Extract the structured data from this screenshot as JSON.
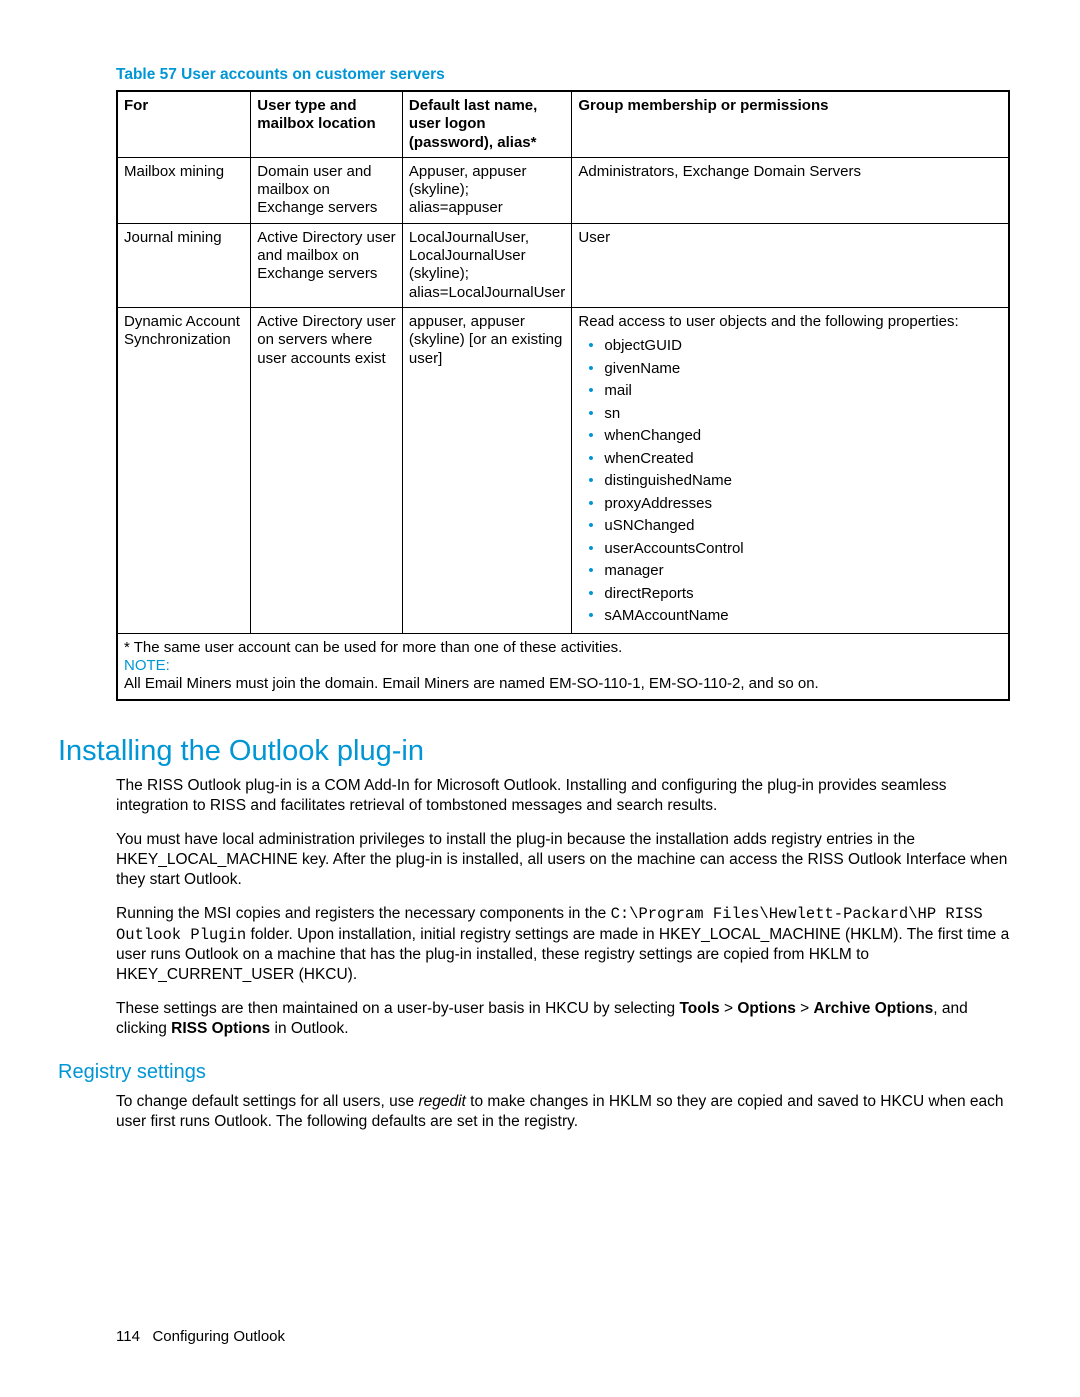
{
  "table": {
    "caption": "Table 57 User accounts on customer servers",
    "headers": {
      "c1": "For",
      "c2": "User type and mailbox location",
      "c3": "Default last name, user logon (password), alias*",
      "c4": "Group membership or permissions"
    },
    "rows": [
      {
        "c1": "Mailbox mining",
        "c2": "Domain user and mailbox on Exchange servers",
        "c3": "Appuser, appuser (skyline); alias=appuser",
        "c4_text": "Administrators, Exchange Domain Servers",
        "c4_list": null
      },
      {
        "c1": "Journal mining",
        "c2": "Active Directory user and mailbox on Exchange servers",
        "c3": "LocalJournalUser, LocalJournalUser (skyline); alias=LocalJournalUser",
        "c4_text": "User",
        "c4_list": null
      },
      {
        "c1": "Dynamic Account Synchronization",
        "c2": "Active Directory user on servers where user accounts exist",
        "c3": "appuser, appuser (skyline) [or an existing user]",
        "c4_text": "Read access to user objects and the following properties:",
        "c4_list": [
          "objectGUID",
          "givenName",
          "mail",
          "sn",
          "whenChanged",
          "whenCreated",
          "distinguishedName",
          "proxyAddresses",
          "uSNChanged",
          "userAccountsControl",
          "manager",
          "directReports",
          "sAMAccountName"
        ]
      }
    ],
    "footnote": "* The same user account can be used for more than one of these activities.",
    "note_label": "NOTE:",
    "note_body": "All Email Miners must join the domain. Email Miners are named EM-SO-110-1, EM-SO-110-2, and so on."
  },
  "section1": {
    "heading": "Installing the Outlook plug-in",
    "p1": "The RISS Outlook plug-in is a COM Add-In for Microsoft Outlook. Installing and configuring the plug-in provides seamless integration to RISS and facilitates retrieval of tombstoned messages and search results.",
    "p2": "You must have local administration privileges to install the plug-in because the installation adds registry entries in the HKEY_LOCAL_MACHINE key. After the plug-in is installed, all users on the machine can access the RISS Outlook Interface when they start Outlook.",
    "p3_a": "Running the MSI copies and registers the necessary components in the ",
    "p3_code": "C:\\Program Files\\Hewlett-Packard\\HP RISS Outlook Plugin",
    "p3_b": " folder. Upon installation, initial registry settings are made in HKEY_LOCAL_MACHINE (HKLM). The first time a user runs Outlook on a machine that has the plug-in installed, these registry settings are copied from HKLM to HKEY_CURRENT_USER (HKCU).",
    "p4_a": "These settings are then maintained on a user-by-user basis in HKCU by selecting ",
    "p4_b1": "Tools",
    "p4_sep1": " > ",
    "p4_b2": "Options",
    "p4_sep2": " > ",
    "p4_b3": "Archive Options",
    "p4_mid": ", and clicking ",
    "p4_b4": "RISS Options",
    "p4_end": " in Outlook."
  },
  "section2": {
    "heading": "Registry settings",
    "p1_a": "To change default settings for all users, use ",
    "p1_i": "regedit",
    "p1_b": " to make changes in HKLM so they are copied and saved to HKCU when each user first runs Outlook. The following defaults are set in the registry."
  },
  "footer": {
    "page": "114",
    "title": "Configuring Outlook"
  }
}
